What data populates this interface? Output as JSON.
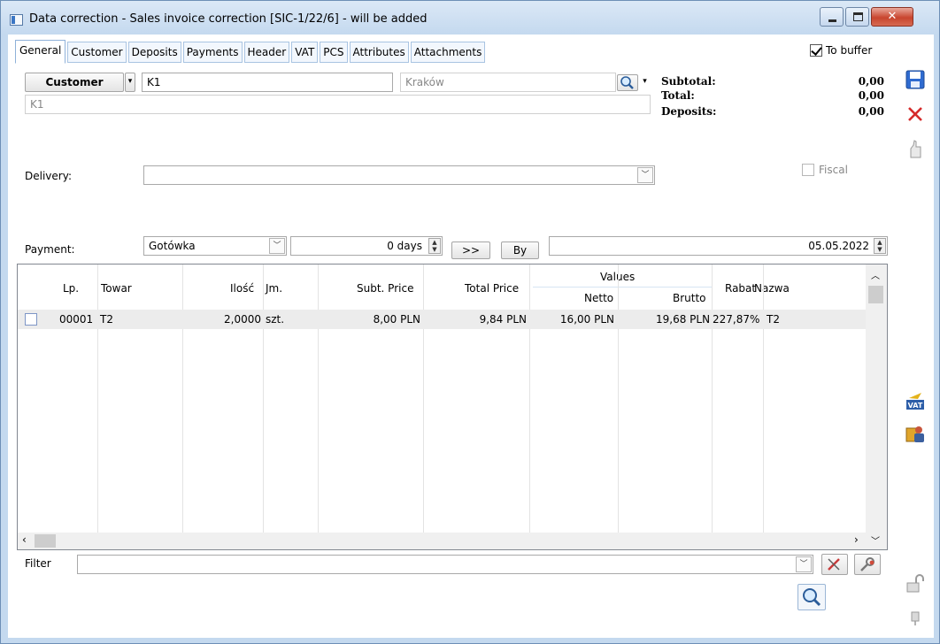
{
  "window": {
    "title": "Data correction - Sales invoice correction [SIC-1/22/6]  - will be added",
    "close_glyph": "✕"
  },
  "tabs": [
    "General",
    "Customer",
    "Deposits",
    "Payments",
    "Header",
    "VAT",
    "PCS",
    "Attributes",
    "Attachments"
  ],
  "buffer": {
    "label": "To buffer",
    "checked": true
  },
  "customer": {
    "button_label": "Customer",
    "code": "K1",
    "city": "Kraków",
    "name": "K1"
  },
  "totals": {
    "subtotal_label": "Subtotal:",
    "subtotal": "0,00",
    "total_label": "Total:",
    "total": "0,00",
    "deposits_label": "Deposits:",
    "deposits": "0,00"
  },
  "delivery": {
    "label": "Delivery:",
    "value": ""
  },
  "fiscal": {
    "label": "Fiscal",
    "checked": false
  },
  "payment": {
    "label": "Payment:",
    "method": "Gotówka",
    "days": "0 days",
    "arrow_button": ">>",
    "by_button": "By",
    "date": "05.05.2022"
  },
  "grid": {
    "headers": {
      "lp": "Lp.",
      "towar": "Towar",
      "ilosc": "Ilość",
      "jm": "Jm.",
      "subt_price": "Subt. Price",
      "total_price": "Total Price",
      "values": "Values",
      "netto": "Netto",
      "brutto": "Brutto",
      "rabat": "Rabat",
      "nazwa": "Nazwa"
    },
    "rows": [
      {
        "lp": "00001",
        "towar": "T2",
        "ilosc": "2,0000",
        "jm": "szt.",
        "subt_price": "8,00 PLN",
        "total_price": "9,84 PLN",
        "netto": "16,00 PLN",
        "brutto": "19,68 PLN",
        "rabat": "227,87%",
        "nazwa": "T2"
      }
    ]
  },
  "filter": {
    "label": "Filter",
    "value": ""
  },
  "colors": {
    "title_bar": "#c4d9ef",
    "close_button": "#c8452e",
    "selected_row": "#ececec"
  }
}
